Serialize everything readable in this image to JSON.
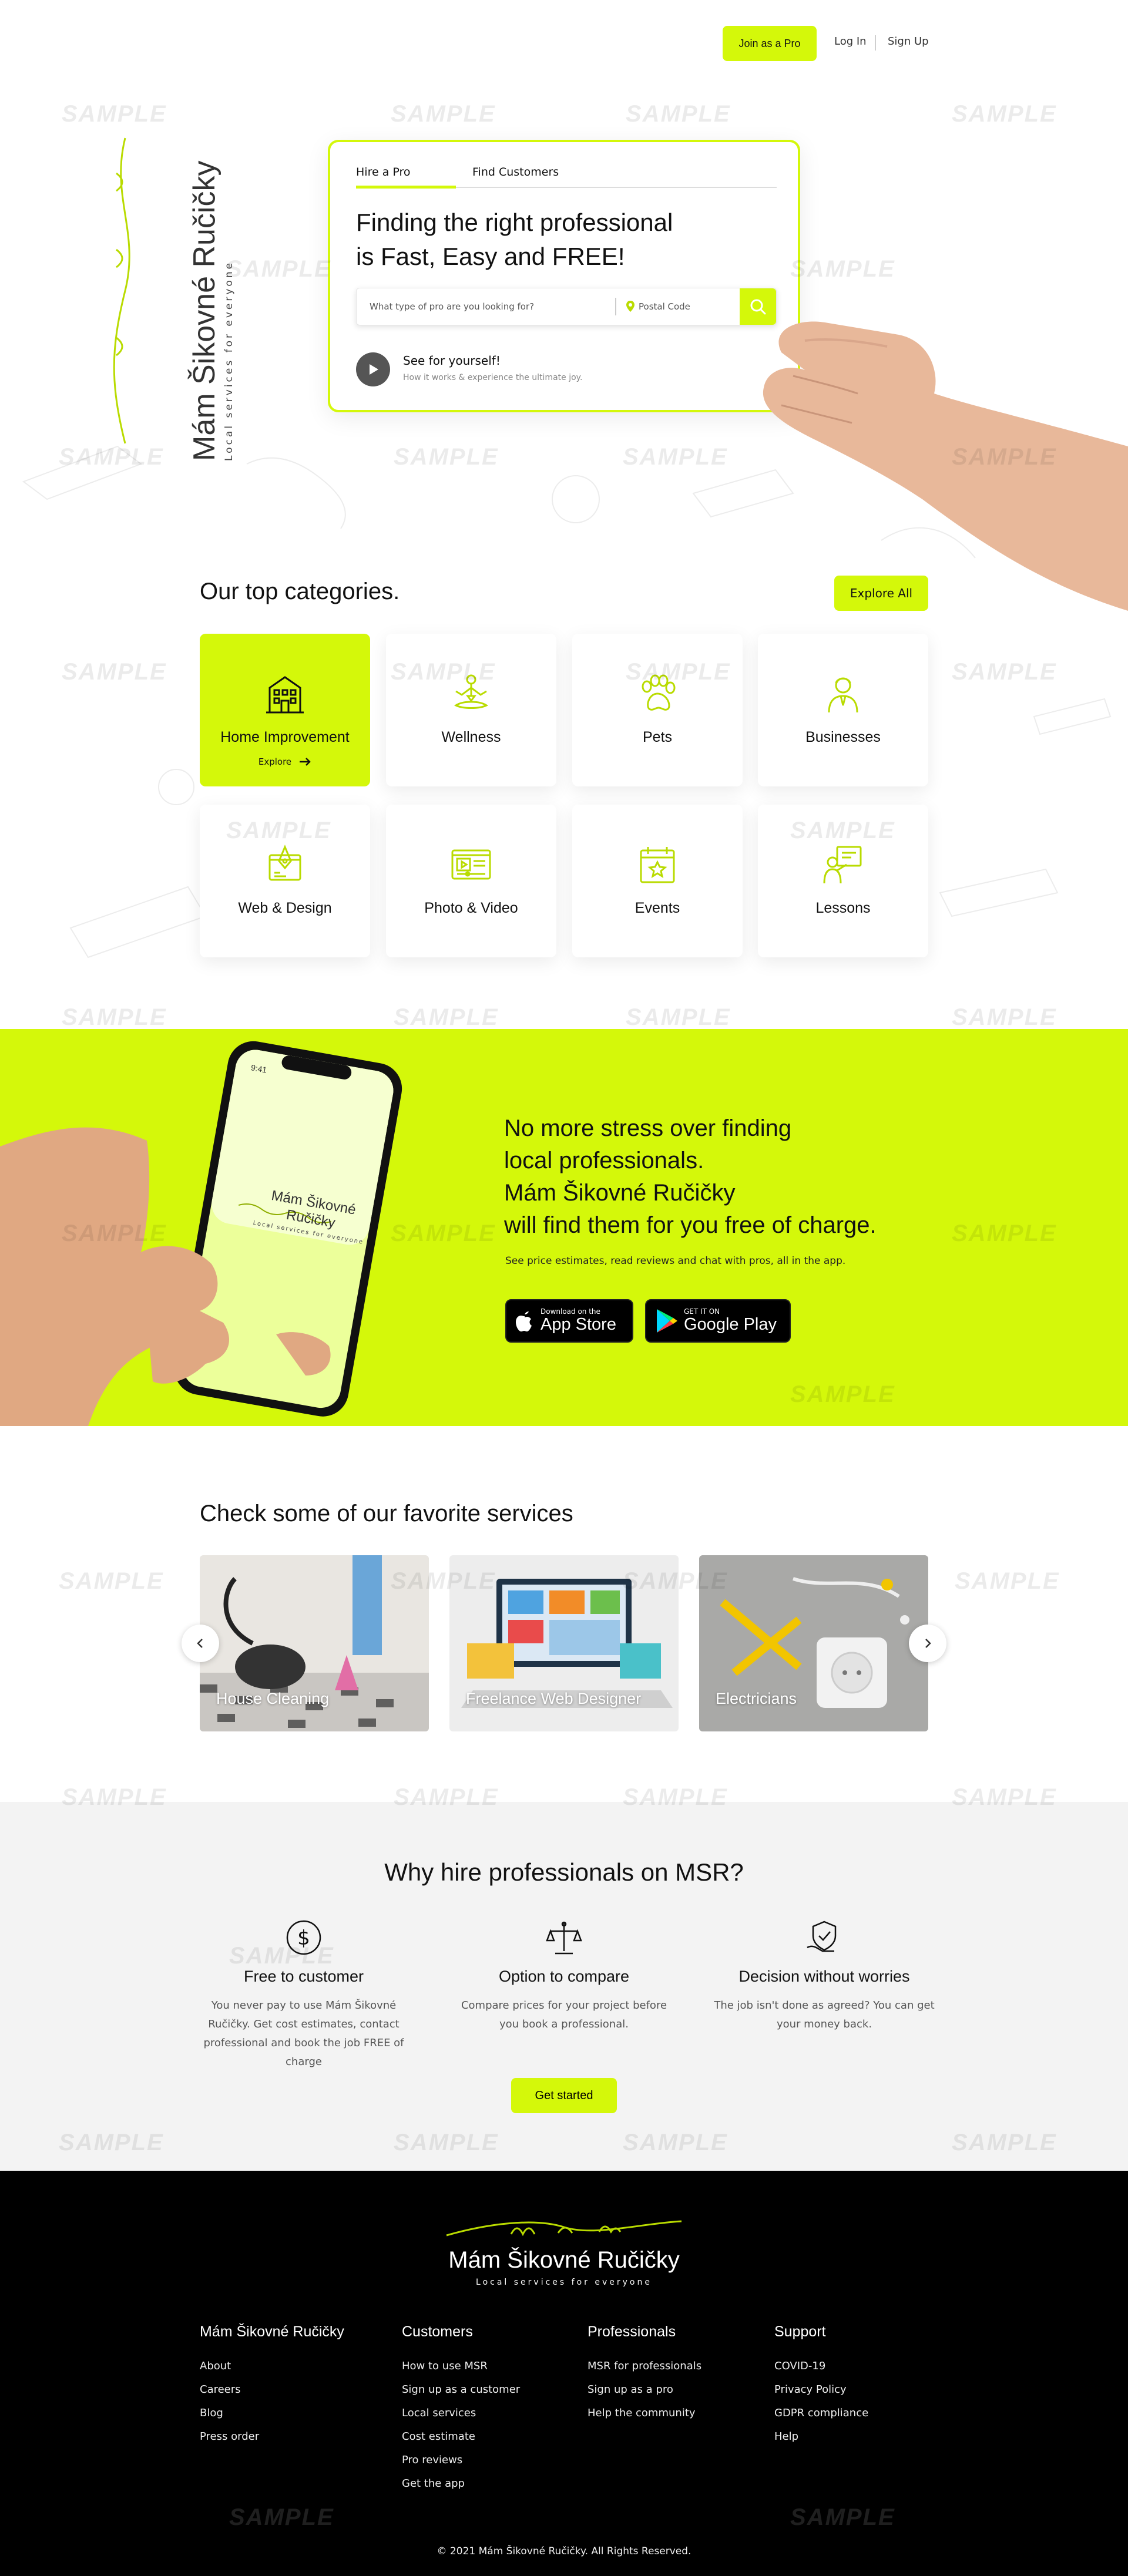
{
  "nav": {
    "join_label": "Join as a Pro",
    "login_label": "Log In",
    "signup_label": "Sign Up"
  },
  "brand": {
    "name": "Mám Šikovné Ručičky",
    "tagline": "Local services for everyone",
    "logo_script": "msr",
    "accent_color": "#d4f80a"
  },
  "hero": {
    "tabs": [
      {
        "label": "Hire a Pro",
        "active": true
      },
      {
        "label": "Find Customers",
        "active": false
      }
    ],
    "title_line1": "Finding the right professional",
    "title_line2": "is Fast, Easy and FREE!",
    "search_placeholder": "What type of pro are you looking for?",
    "postal_placeholder": "Postal Code",
    "search_icon": "search-icon",
    "video_title": "See for yourself!",
    "video_subtitle": "How it works & experience the ultimate joy."
  },
  "categories": {
    "title": "Our top categories.",
    "explore_all_label": "Explore All",
    "items": [
      {
        "label": "Home Improvement",
        "icon": "building-icon",
        "active": true,
        "explore_label": "Explore"
      },
      {
        "label": "Wellness",
        "icon": "meditation-icon",
        "active": false
      },
      {
        "label": "Pets",
        "icon": "paw-icon",
        "active": false
      },
      {
        "label": "Businesses",
        "icon": "businessman-icon",
        "active": false
      },
      {
        "label": "Web & Design",
        "icon": "design-icon",
        "active": false
      },
      {
        "label": "Photo & Video",
        "icon": "video-player-icon",
        "active": false
      },
      {
        "label": "Events",
        "icon": "calendar-star-icon",
        "active": false
      },
      {
        "label": "Lessons",
        "icon": "teacher-board-icon",
        "active": false
      }
    ]
  },
  "banner": {
    "line1": "No more stress over finding",
    "line2": "local professionals.",
    "line3": "Mám Šikovné Ručičky",
    "line4": "will find them for you free of charge.",
    "subtitle": "See price estimates, read reviews and chat with pros, all in the app.",
    "phone_brand": "Mám Šikovné Ručičky",
    "phone_tagline": "Local services for everyone",
    "appstore_small": "Download on the",
    "appstore_big": "App Store",
    "googleplay_small": "GET IT ON",
    "googleplay_big": "Google Play"
  },
  "services": {
    "title": "Check some of our favorite services",
    "items": [
      {
        "label": "House Cleaning"
      },
      {
        "label": "Freelance Web Designer"
      },
      {
        "label": "Electricians"
      }
    ]
  },
  "why": {
    "title": "Why hire professionals on MSR?",
    "columns": [
      {
        "icon": "dollar-coin-icon",
        "title": "Free to customer",
        "text": "You never pay to use Mám Šikovné Ručičky. Get cost estimates, contact professional and book the job FREE of charge"
      },
      {
        "icon": "scales-icon",
        "title": "Option to compare",
        "text": "Compare prices for your project before you book a professional."
      },
      {
        "icon": "shield-hand-icon",
        "title": "Decision without worries",
        "text": "The job isn't done as agreed? You can get your money back."
      }
    ],
    "cta_label": "Get started"
  },
  "footer": {
    "columns": [
      {
        "heading": "Mám Šikovné Ručičky",
        "links": [
          "About",
          "Careers",
          "Blog",
          "Press order"
        ]
      },
      {
        "heading": "Customers",
        "links": [
          "How to use MSR",
          "Sign up as a customer",
          "Local services",
          "Cost estimate",
          "Pro reviews",
          "Get the app"
        ]
      },
      {
        "heading": "Professionals",
        "links": [
          "MSR for professionals",
          "Sign up as a pro",
          "Help the community"
        ]
      },
      {
        "heading": "Support",
        "links": [
          "COVID-19",
          "Privacy Policy",
          "GDPR compliance",
          "Help"
        ]
      }
    ],
    "copyright": "© 2021 Mám Šikovné Ručičky. All Rights Reserved."
  },
  "watermark": "SAMPLE"
}
